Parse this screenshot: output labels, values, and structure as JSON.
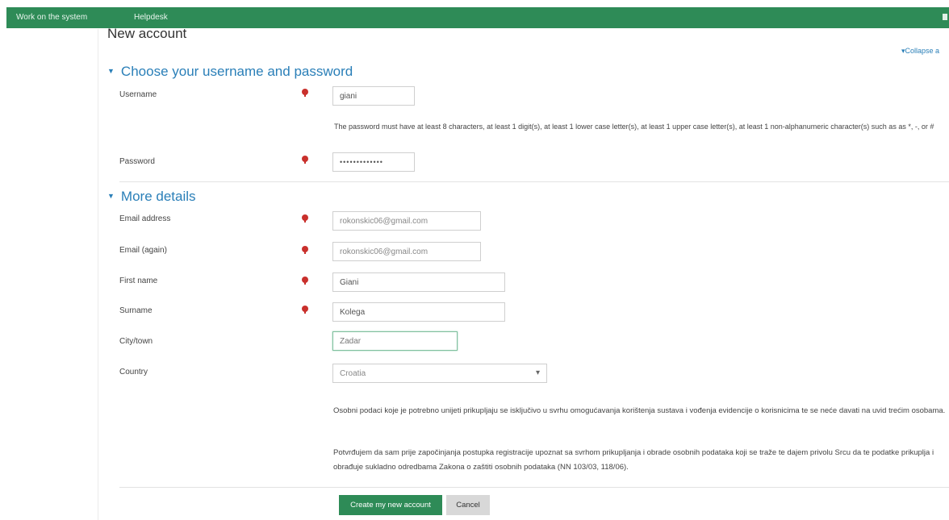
{
  "nav": {
    "item1": "Work on the system",
    "item2": "Helpdesk"
  },
  "page": {
    "title": "New account",
    "collapse_link": "▾Collapse a"
  },
  "section1": {
    "title": "Choose your username and password",
    "username_label": "Username",
    "username_value": "giani",
    "password_help": "The password must have at least 8 characters, at least 1 digit(s), at least 1 lower case letter(s), at least 1 upper case letter(s), at least 1 non-alphanumeric character(s) such as as *, -, or #",
    "password_label": "Password",
    "password_value": "•••••••••••••"
  },
  "section2": {
    "title": "More details",
    "email_label": "Email address",
    "email_value": "rokonskic06@gmail.com",
    "email_again_label": "Email (again)",
    "email_again_value": "rokonskic06@gmail.com",
    "first_name_label": "First name",
    "first_name_value": "Giani",
    "surname_label": "Surname",
    "surname_value": "Kolega",
    "city_label": "City/town",
    "city_value": "Zadar",
    "country_label": "Country",
    "country_value": "Croatia"
  },
  "privacy": {
    "paragraph1": "Osobni podaci koje je potrebno unijeti prikupljaju se isključivo u svrhu omogućavanja korištenja sustava i vođenja evidencije o korisnicima te se neće davati na uvid trećim osobama.",
    "paragraph2": "Potvrđujem da sam prije započinjanja postupka registracije upoznat sa svrhom prikupljanja i obrade osobnih podataka koji se traže te dajem privolu Srcu da te podatke prikuplja i obrađuje sukladno odredbama Zakona o zaštiti osobnih podataka (NN 103/03, 118/06)."
  },
  "buttons": {
    "create": "Create my new account",
    "cancel": "Cancel"
  },
  "colors": {
    "brand_green": "#2e8b57",
    "link_blue": "#2a7fb8",
    "required_red": "#c9302c"
  }
}
